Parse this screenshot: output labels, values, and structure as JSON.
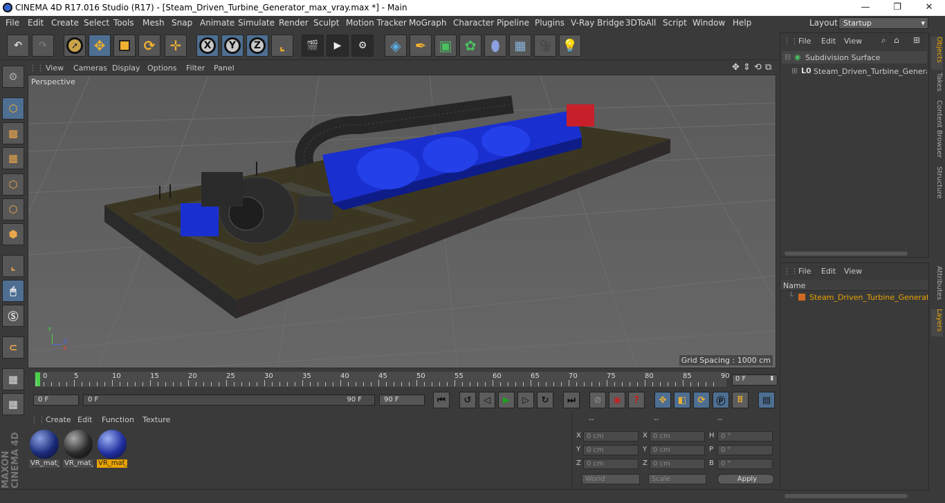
{
  "titlebar": {
    "title": "CINEMA 4D R17.016 Studio (R17) - [Steam_Driven_Turbine_Generator_max_vray.max *] - Main",
    "minimize": "—",
    "maximize": "❐",
    "close": "✕"
  },
  "menu": [
    "File",
    "Edit",
    "Create",
    "Select",
    "Tools",
    "Mesh",
    "Snap",
    "Animate",
    "Simulate",
    "Render",
    "Sculpt",
    "Motion Tracker",
    "MoGraph",
    "Character",
    "Pipeline",
    "Plugins",
    "V-Ray Bridge",
    "3DToAll",
    "Script",
    "Window",
    "Help"
  ],
  "layout": {
    "label": "Layout:",
    "value": "Startup"
  },
  "toolbar": {
    "x": "X",
    "y": "Y",
    "z": "Z"
  },
  "viewport": {
    "menu": [
      "View",
      "Cameras",
      "Display",
      "Options",
      "Filter",
      "Panel"
    ],
    "label": "Perspective",
    "grid_spacing": "Grid Spacing : 1000 cm",
    "axis_y": "Y",
    "axis_z": "Z",
    "axis_x": "X"
  },
  "timeline": {
    "ticks": [
      "0",
      "5",
      "10",
      "15",
      "20",
      "25",
      "30",
      "35",
      "40",
      "45",
      "50",
      "55",
      "60",
      "65",
      "70",
      "75",
      "80",
      "85",
      "90"
    ],
    "current": "0 F"
  },
  "transport": {
    "start": "0 F",
    "slider_start": "0 F",
    "slider_end": "90 F",
    "end": "90 F"
  },
  "materials": {
    "menu": [
      "Create",
      "Edit",
      "Function",
      "Texture"
    ],
    "items": [
      {
        "label": "VR_mat_",
        "selected": false
      },
      {
        "label": "VR_mat_",
        "selected": false
      },
      {
        "label": "VR_mat_",
        "selected": true
      }
    ]
  },
  "coords": {
    "headers": [
      "--",
      "--",
      "--"
    ],
    "rows": [
      {
        "a": "X",
        "av": "0 cm",
        "b": "X",
        "bv": "0 cm",
        "c": "H",
        "cv": "0 °"
      },
      {
        "a": "Y",
        "av": "0 cm",
        "b": "Y",
        "bv": "0 cm",
        "c": "P",
        "cv": "0 °"
      },
      {
        "a": "Z",
        "av": "0 cm",
        "b": "Z",
        "bv": "0 cm",
        "c": "B",
        "cv": "0 °"
      }
    ],
    "world": "World",
    "scale": "Scale",
    "apply": "Apply"
  },
  "objects": {
    "menu": [
      "File",
      "Edit",
      "View"
    ],
    "items": [
      {
        "label": "Subdivision Surface"
      },
      {
        "label": "Steam_Driven_Turbine_Generator"
      }
    ]
  },
  "layers": {
    "menu": [
      "File",
      "Edit",
      "View"
    ],
    "name_header": "Name",
    "items": [
      {
        "label": "Steam_Driven_Turbine_Generator"
      }
    ]
  },
  "sidetabs": [
    "Objects",
    "Takes",
    "Content Browser",
    "Structure",
    "Attributes",
    "Layers"
  ],
  "brand": "MAXON CINEMA 4D",
  "colors": {
    "accent": "#e8a300",
    "selected_tool": "#4e6f92",
    "turbine_blue": "#1a2fd0"
  }
}
